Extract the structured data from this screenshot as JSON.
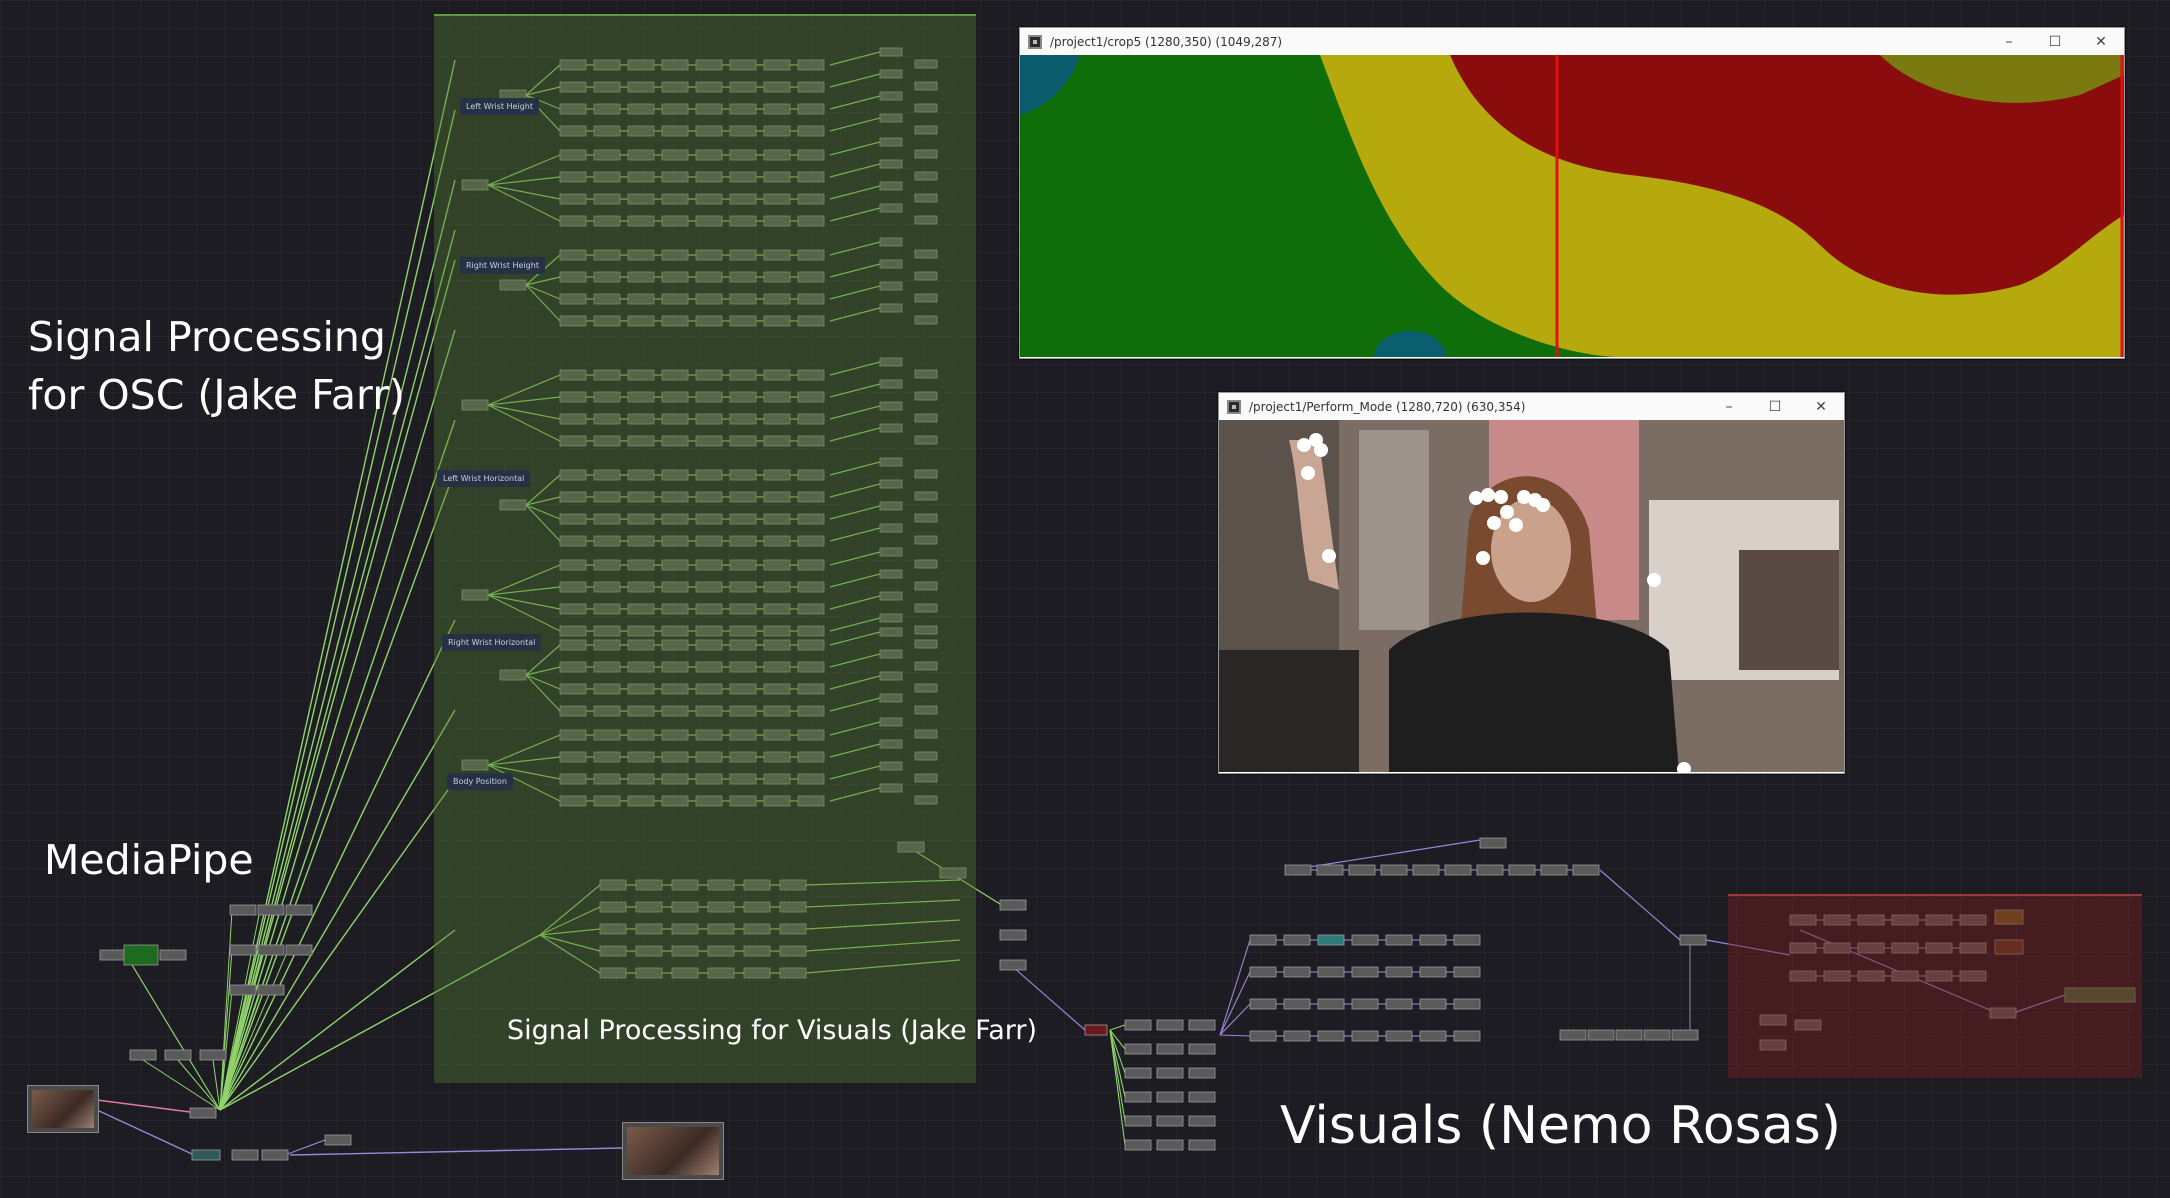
{
  "labels": {
    "osc_line1": "Signal Processing",
    "osc_line2": "for OSC (Jake Farr)",
    "mediapipe": "MediaPipe",
    "visuals_sp": "Signal Processing for Visuals (Jake Farr)",
    "visuals": "Visuals (Nemo Rosas)"
  },
  "notes": {
    "left_wrist_height": "Left Wrist Height",
    "right_wrist_height": "Right Wrist Height",
    "left_wrist_horizontal": "Left Wrist Horizontal",
    "right_wrist_horizontal": "Right Wrist Horizontal",
    "body_position": "Body Position"
  },
  "windows": {
    "crop": {
      "title": "/project1/crop5 (1280,350) (1049,287)",
      "minimize": "–",
      "maximize": "☐",
      "close": "✕"
    },
    "perform": {
      "title": "/project1/Perform_Mode (1280,720) (630,354)",
      "minimize": "–",
      "maximize": "☐",
      "close": "✕"
    }
  },
  "colors": {
    "wire_green": "#8fd46a",
    "wire_purple": "#9d86d6",
    "wire_pink": "#e07aa8",
    "region_green": "#52783a",
    "region_red": "#782020",
    "crop_green": "#0f6e0a",
    "crop_yellow": "#b5a90e",
    "crop_red": "#8a0c0c"
  }
}
